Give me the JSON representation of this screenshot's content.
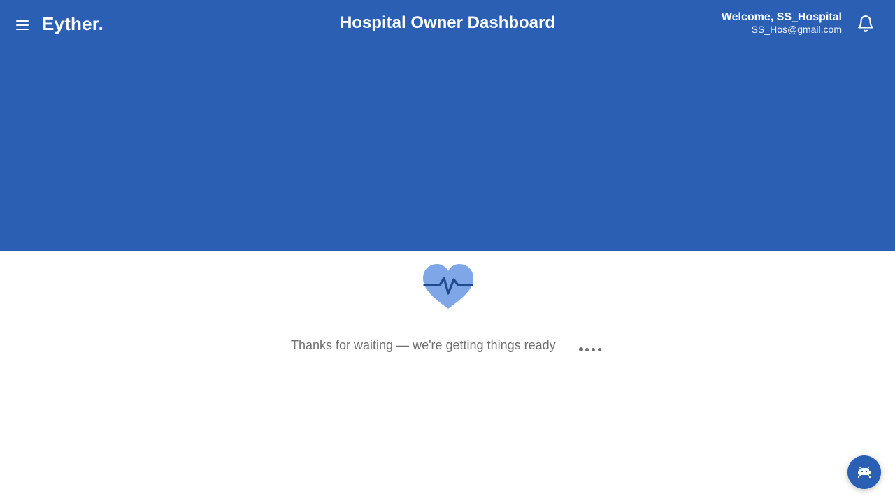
{
  "header": {
    "brand": "Eyther.",
    "title": "Hospital Owner Dashboard",
    "user": {
      "welcome": "Welcome, SS_Hospital",
      "email": "SS_Hos@gmail.com"
    },
    "icons": {
      "menu": "menu-icon",
      "notifications": "bell-icon"
    }
  },
  "loading": {
    "message": "Thanks for waiting — we're getting things ready",
    "icon": "heartbeat-icon",
    "dots_count": 4
  },
  "fab": {
    "icon": "bot-icon"
  },
  "colors": {
    "primary": "#2a5fb4",
    "heart_fill": "#7fa6e6",
    "heart_line": "#1f4a8f",
    "text_muted": "#6f6f6f"
  }
}
